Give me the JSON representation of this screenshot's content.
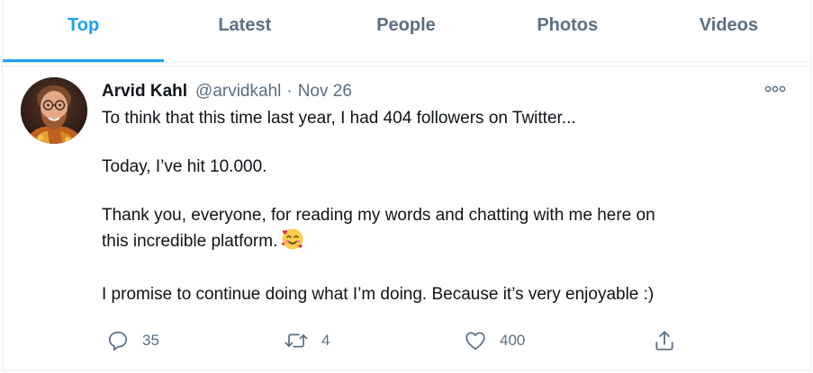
{
  "tabs": [
    {
      "label": "Top",
      "active": true
    },
    {
      "label": "Latest",
      "active": false
    },
    {
      "label": "People",
      "active": false
    },
    {
      "label": "Photos",
      "active": false
    },
    {
      "label": "Videos",
      "active": false
    }
  ],
  "tweet": {
    "author_name": "Arvid Kahl",
    "author_handle": "@arvidkahl",
    "separator": "·",
    "timestamp": "Nov 26",
    "more_icon": "more-dots-icon",
    "paragraphs": [
      "To think that this time last year, I had 404 followers on Twitter...",
      "Today, I’ve hit 10.000.",
      "Thank you, everyone, for reading my words and chatting with me here on",
      "this incredible platform.",
      "I promise to continue doing what I’m doing. Because it’s very enjoyable :)"
    ],
    "emoji": "smiling-face-with-hearts-emoji",
    "actions": {
      "reply": {
        "icon": "reply-icon",
        "count": "35"
      },
      "retweet": {
        "icon": "retweet-icon",
        "count": "4"
      },
      "like": {
        "icon": "heart-icon",
        "count": "400"
      },
      "share": {
        "icon": "share-icon",
        "count": ""
      }
    }
  },
  "colors": {
    "accent": "#1da1f2",
    "muted": "#5b7083",
    "text": "#0f1419",
    "border": "#e6ecf0"
  }
}
